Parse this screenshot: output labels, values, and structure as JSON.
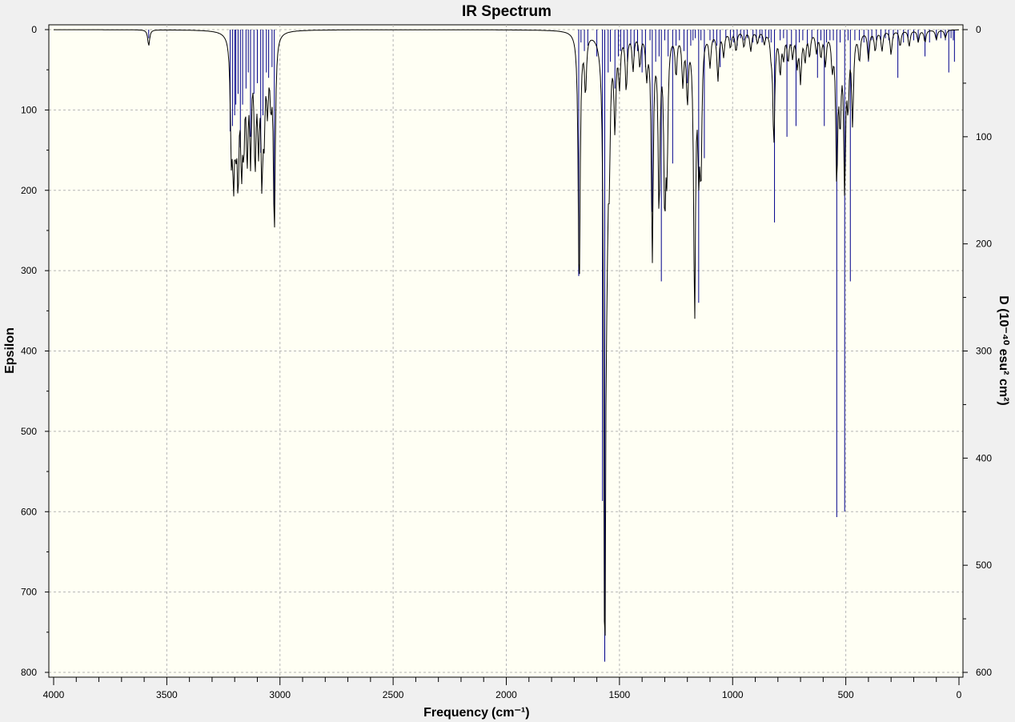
{
  "chart_data": {
    "type": "line",
    "title": "IR Spectrum",
    "xlabel": "Frequency",
    "xlabel_unit": "(cm⁻¹)",
    "ylabel_left": "Epsilon",
    "ylabel_right": "D (10⁻⁴⁰ esu² cm²)",
    "xlim": [
      4000,
      0
    ],
    "ylim_left": [
      0,
      800
    ],
    "ylim_right": [
      0,
      600
    ],
    "x_ticks": [
      4000,
      3500,
      3000,
      2500,
      2000,
      1500,
      1000,
      500,
      0
    ],
    "y_left_ticks": [
      0,
      100,
      200,
      300,
      400,
      500,
      600,
      700,
      800
    ],
    "y_right_ticks": [
      0,
      100,
      200,
      300,
      400,
      500,
      600
    ],
    "grid": true,
    "y_inverted": true,
    "series": [
      {
        "role": "stick_spectrum",
        "color": "#00008b",
        "axis": "right",
        "x": [
          3580,
          3220,
          3210,
          3200,
          3195,
          3185,
          3175,
          3165,
          3150,
          3140,
          3130,
          3115,
          3100,
          3085,
          3075,
          3060,
          3050,
          3035,
          3025,
          1680,
          1670,
          1655,
          1640,
          1600,
          1575,
          1565,
          1550,
          1540,
          1520,
          1505,
          1495,
          1480,
          1465,
          1450,
          1435,
          1420,
          1400,
          1385,
          1365,
          1355,
          1340,
          1325,
          1315,
          1300,
          1285,
          1265,
          1250,
          1235,
          1215,
          1200,
          1185,
          1175,
          1165,
          1150,
          1140,
          1125,
          1100,
          1085,
          1070,
          1055,
          1030,
          1010,
          995,
          980,
          965,
          950,
          935,
          910,
          895,
          880,
          870,
          855,
          840,
          830,
          815,
          790,
          775,
          760,
          740,
          720,
          705,
          690,
          670,
          650,
          625,
          610,
          595,
          585,
          570,
          555,
          540,
          525,
          505,
          490,
          480,
          460,
          440,
          420,
          400,
          385,
          365,
          345,
          325,
          310,
          290,
          270,
          245,
          225,
          200,
          180,
          150,
          130,
          100,
          80,
          60,
          45,
          35,
          25,
          20
        ],
        "values": [
          8,
          95,
          90,
          80,
          70,
          60,
          110,
          70,
          55,
          40,
          100,
          60,
          50,
          115,
          80,
          40,
          45,
          35,
          170,
          230,
          12,
          20,
          15,
          25,
          440,
          590,
          40,
          30,
          55,
          25,
          20,
          18,
          30,
          15,
          25,
          20,
          40,
          35,
          10,
          170,
          30,
          25,
          235,
          10,
          25,
          125,
          15,
          10,
          20,
          50,
          15,
          10,
          8,
          255,
          10,
          120,
          10,
          12,
          15,
          35,
          8,
          10,
          12,
          15,
          8,
          10,
          8,
          12,
          10,
          8,
          12,
          10,
          8,
          12,
          180,
          10,
          8,
          100,
          15,
          90,
          12,
          10,
          15,
          8,
          45,
          10,
          90,
          12,
          10,
          10,
          455,
          12,
          450,
          10,
          235,
          10,
          10,
          12,
          30,
          10,
          10,
          10,
          8,
          10,
          8,
          45,
          12,
          8,
          10,
          10,
          25,
          12,
          10,
          8,
          10,
          40,
          8,
          10,
          30
        ]
      },
      {
        "role": "broadened_spectrum",
        "color": "#000000",
        "axis": "left",
        "x": [
          3580,
          3215,
          3205,
          3195,
          3185,
          3170,
          3160,
          3145,
          3130,
          3110,
          3095,
          3080,
          3070,
          3055,
          3040,
          3025,
          1678,
          1650,
          1565,
          1555,
          1545,
          1520,
          1500,
          1470,
          1440,
          1410,
          1380,
          1355,
          1325,
          1300,
          1290,
          1250,
          1220,
          1200,
          1168,
          1150,
          1140,
          1100,
          1065,
          1040,
          1010,
          985,
          950,
          920,
          890,
          860,
          830,
          818,
          790,
          775,
          755,
          735,
          715,
          700,
          680,
          660,
          630,
          610,
          590,
          560,
          540,
          525,
          505,
          490,
          470,
          440,
          400,
          370,
          340,
          300,
          260,
          220,
          180,
          150,
          100,
          60
        ],
        "values": [
          20,
          130,
          150,
          90,
          160,
          140,
          110,
          135,
          140,
          150,
          120,
          160,
          100,
          80,
          70,
          245,
          330,
          70,
          790,
          150,
          130,
          110,
          60,
          70,
          45,
          40,
          50,
          280,
          215,
          200,
          150,
          50,
          60,
          80,
          350,
          140,
          160,
          40,
          60,
          30,
          20,
          25,
          20,
          25,
          15,
          15,
          20,
          140,
          50,
          30,
          35,
          30,
          40,
          60,
          35,
          30,
          25,
          30,
          40,
          40,
          180,
          100,
          190,
          80,
          110,
          35,
          35,
          25,
          25,
          30,
          20,
          20,
          15,
          15,
          12,
          10
        ]
      }
    ]
  },
  "colors": {
    "plot_bg": "#fffff4",
    "window_bg": "#f0f0f0",
    "grid": "#b5b5b5",
    "stick": "#00008b",
    "curve": "#000000"
  }
}
